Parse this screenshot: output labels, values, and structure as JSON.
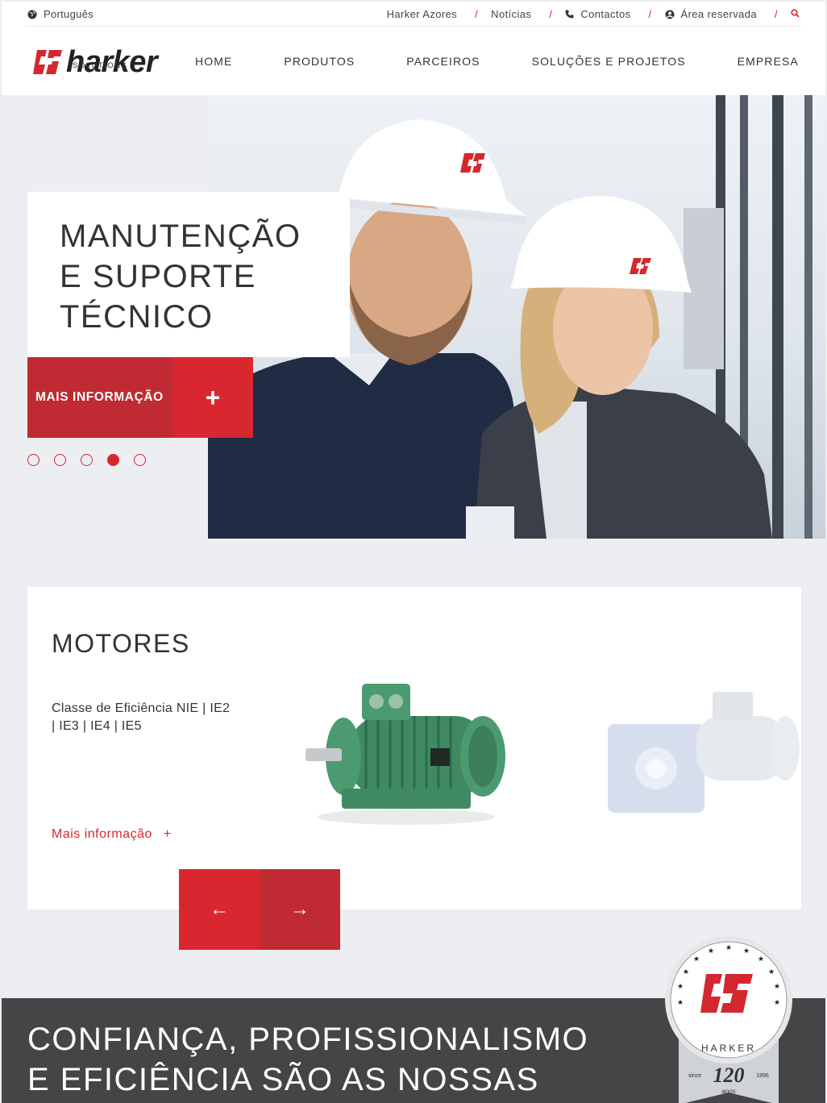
{
  "topbar": {
    "language": "Português",
    "links": [
      {
        "label": "Harker Azores"
      },
      {
        "label": "Notícias"
      },
      {
        "label": "Contactos"
      },
      {
        "label": "Área reservada"
      }
    ],
    "icons": {
      "language": "globe-icon",
      "contact": "phone-icon",
      "account": "user-circle-icon",
      "search": "search-icon"
    }
  },
  "header": {
    "logo_text": "harker",
    "logo_sub": "SOLUTIONS",
    "nav": [
      "HOME",
      "PRODUTOS",
      "PARCEIROS",
      "SOLUÇÕES E PROJETOS",
      "EMPRESA"
    ]
  },
  "hero": {
    "title_lines": [
      "MANUTENÇÃO",
      "E SUPORTE",
      "TÉCNICO"
    ],
    "cta_label": "MAIS INFORMAÇÃO",
    "cta_icon": "+",
    "slides_total": 5,
    "active_slide": 4
  },
  "product": {
    "title": "MOTORES",
    "description": "Classe de Eficiência   NIE | IE2 | IE3 | IE4 | IE5",
    "link_label": "Mais informação",
    "link_icon": "+",
    "prev_icon": "←",
    "next_icon": "→"
  },
  "band": {
    "lines": [
      "CONFIANÇA, PROFISSIONALISMO",
      "E EFICIÊNCIA SÃO AS NOSSAS"
    ]
  },
  "badge": {
    "brand": "HARKER",
    "since": "since",
    "year": "1896",
    "number": "120",
    "unit": "anos"
  },
  "colors": {
    "accent": "#d9272f",
    "accent_dark": "#bf2a33",
    "band": "#454547",
    "bg": "#eceef1"
  }
}
